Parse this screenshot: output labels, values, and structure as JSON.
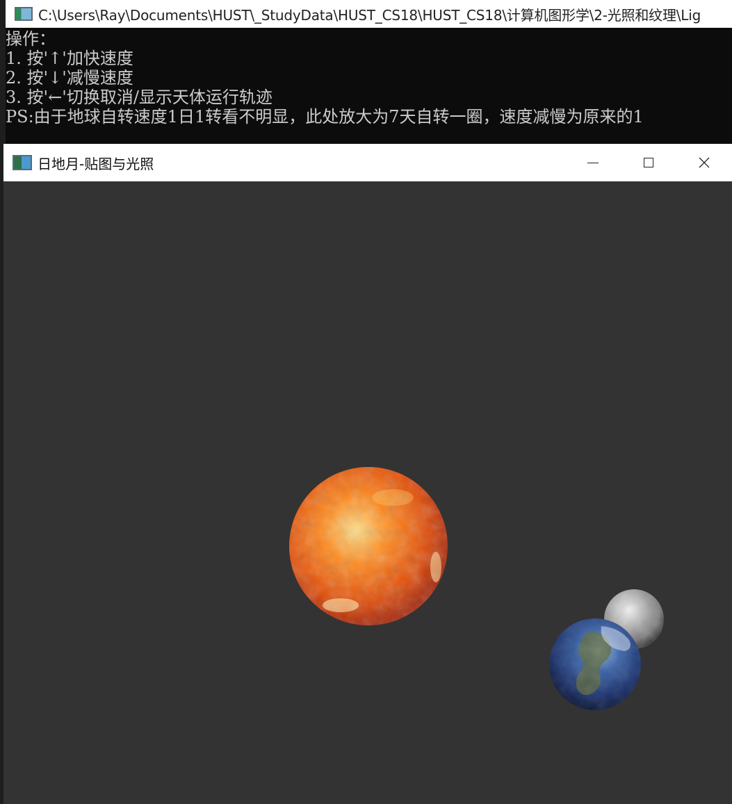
{
  "console": {
    "title": "C:\\Users\\Ray\\Documents\\HUST\\_StudyData\\HUST_CS18\\HUST_CS18\\计算机图形学\\2-光照和纹理\\Lig",
    "lines": [
      "操作：",
      "1. 按'↑'加快速度",
      "2. 按'↓'减慢速度",
      "3. 按'←'切换取消/显示天体运行轨迹",
      "PS:由于地球自转速度1日1转看不明显，此处放大为7天自转一圈，速度减慢为原来的1"
    ],
    "icon": "cmd-icon"
  },
  "gl_window": {
    "title": "日地月-贴图与光照",
    "icon": "app-icon",
    "controls": {
      "minimize": "minimize-icon",
      "maximize": "maximize-icon",
      "close": "close-icon"
    },
    "scene": {
      "background": "#333333",
      "bodies": [
        {
          "name": "sun",
          "colors": [
            "#ffe08a",
            "#ff8a1e",
            "#e24e0a",
            "#a8280a"
          ]
        },
        {
          "name": "earth",
          "colors": [
            "#8fb0d8",
            "#3b64a8",
            "#1b326e",
            "#0c1838"
          ]
        },
        {
          "name": "moon",
          "colors": [
            "#f4f4f4",
            "#b8b8b8",
            "#7a7a7a",
            "#3c3c3c"
          ]
        }
      ]
    }
  }
}
